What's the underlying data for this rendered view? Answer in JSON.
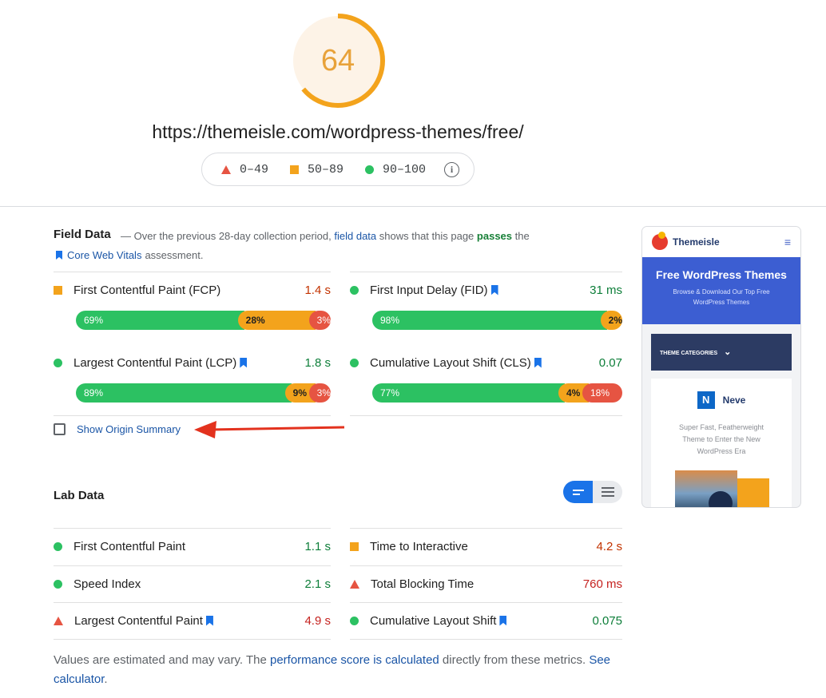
{
  "score": {
    "value": "64",
    "fraction": 0.64,
    "color": "#f3a31c"
  },
  "url": "https://themeisle.com/wordpress-themes/free/",
  "legend": {
    "fail": "0–49",
    "average": "50–89",
    "pass": "90–100",
    "info_icon": "info-icon"
  },
  "field_data": {
    "title": "Field Data",
    "desc_part1": "— Over the previous 28-day collection period,",
    "desc_link": "field data",
    "desc_part2": "shows that this page",
    "desc_passes": "passes",
    "desc_part3": "the",
    "cwv_link": "Core Web Vitals",
    "desc_part4": "assessment.",
    "metrics": [
      {
        "label": "First Contentful Paint (FCP)",
        "value": "1.4 s",
        "status": "average",
        "core": false,
        "good": "69%",
        "ni": "28%",
        "poor": "3%",
        "good_f": 0.69,
        "ni_f": 0.28,
        "poor_f": 0.03
      },
      {
        "label": "First Input Delay (FID)",
        "value": "31 ms",
        "status": "pass",
        "core": true,
        "good": "98%",
        "ni": "2%",
        "poor": "",
        "good_f": 0.98,
        "ni_f": 0.02,
        "poor_f": 0.0
      },
      {
        "label": "Largest Contentful Paint (LCP)",
        "value": "1.8 s",
        "status": "pass",
        "core": true,
        "good": "89%",
        "ni": "9%",
        "poor": "3%",
        "good_f": 0.89,
        "ni_f": 0.09,
        "poor_f": 0.03
      },
      {
        "label": "Cumulative Layout Shift (CLS)",
        "value": "0.07",
        "status": "pass",
        "core": true,
        "good": "77%",
        "ni": "4%",
        "poor": "18%",
        "good_f": 0.77,
        "ni_f": 0.04,
        "poor_f": 0.18
      }
    ],
    "origin_summary": "Show Origin Summary"
  },
  "thumbnail": {
    "brand": "Themeisle",
    "hero_title": "Free WordPress Themes",
    "hero_sub_1": "Browse & Download Our Top Free",
    "hero_sub_2": "WordPress Themes",
    "categories": "THEME CATEGORIES",
    "neve_letter": "N",
    "neve_name": "Neve",
    "neve_txt_1": "Super Fast, Featherweight",
    "neve_txt_2": "Theme to Enter the New",
    "neve_txt_3": "WordPress Era"
  },
  "lab_data": {
    "title": "Lab Data",
    "metrics": [
      {
        "label": "First Contentful Paint",
        "value": "1.1 s",
        "status": "pass",
        "core": false
      },
      {
        "label": "Time to Interactive",
        "value": "4.2 s",
        "status": "average",
        "core": false
      },
      {
        "label": "Speed Index",
        "value": "2.1 s",
        "status": "pass",
        "core": false
      },
      {
        "label": "Total Blocking Time",
        "value": "760 ms",
        "status": "fail",
        "core": false
      },
      {
        "label": "Largest Contentful Paint",
        "value": "4.9 s",
        "status": "fail",
        "core": true
      },
      {
        "label": "Cumulative Layout Shift",
        "value": "0.075",
        "status": "pass",
        "core": true
      }
    ]
  },
  "footer": {
    "part1": "Values are estimated and may vary. The",
    "link1": "performance score is calculated",
    "part2": "directly from these metrics.",
    "link2": "See calculator",
    "part3": "."
  }
}
